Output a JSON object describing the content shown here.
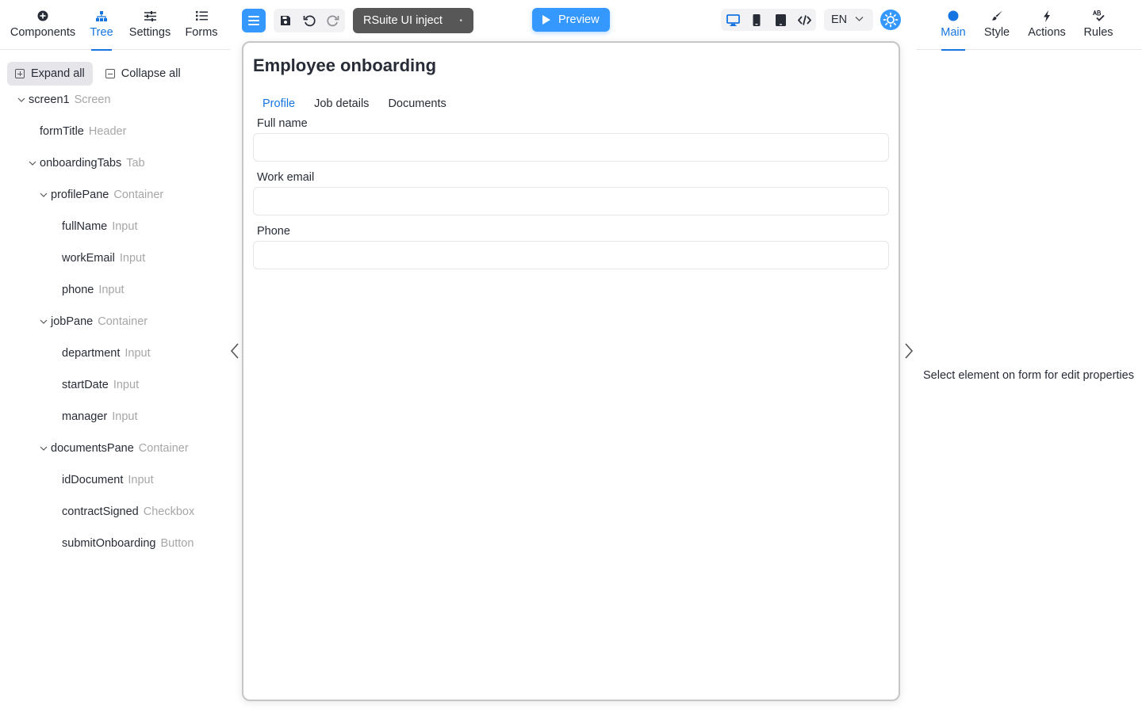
{
  "left_tabs": [
    {
      "label": "Components",
      "icon": "plus-circle-icon",
      "active": false
    },
    {
      "label": "Tree",
      "icon": "sitemap-icon",
      "active": true
    },
    {
      "label": "Settings",
      "icon": "sliders-icon",
      "active": false
    },
    {
      "label": "Forms",
      "icon": "list-icon",
      "active": false
    }
  ],
  "tree_toolbar": {
    "expand_all": "Expand all",
    "collapse_all": "Collapse all"
  },
  "tree": [
    {
      "name": "screen1",
      "type": "Screen",
      "depth": 0,
      "expandable": true
    },
    {
      "name": "formTitle",
      "type": "Header",
      "depth": 1,
      "expandable": false
    },
    {
      "name": "onboardingTabs",
      "type": "Tab",
      "depth": 1,
      "expandable": true
    },
    {
      "name": "profilePane",
      "type": "Container",
      "depth": 2,
      "expandable": true
    },
    {
      "name": "fullName",
      "type": "Input",
      "depth": 3,
      "expandable": false
    },
    {
      "name": "workEmail",
      "type": "Input",
      "depth": 3,
      "expandable": false
    },
    {
      "name": "phone",
      "type": "Input",
      "depth": 3,
      "expandable": false
    },
    {
      "name": "jobPane",
      "type": "Container",
      "depth": 2,
      "expandable": true
    },
    {
      "name": "department",
      "type": "Input",
      "depth": 3,
      "expandable": false
    },
    {
      "name": "startDate",
      "type": "Input",
      "depth": 3,
      "expandable": false
    },
    {
      "name": "manager",
      "type": "Input",
      "depth": 3,
      "expandable": false
    },
    {
      "name": "documentsPane",
      "type": "Container",
      "depth": 2,
      "expandable": true
    },
    {
      "name": "idDocument",
      "type": "Input",
      "depth": 3,
      "expandable": false
    },
    {
      "name": "contractSigned",
      "type": "Checkbox",
      "depth": 3,
      "expandable": false
    },
    {
      "name": "submitOnboarding",
      "type": "Button",
      "depth": 3,
      "expandable": false
    }
  ],
  "toolbar": {
    "library": "RSuite UI inject",
    "preview": "Preview",
    "language": "EN"
  },
  "form": {
    "title": "Employee onboarding",
    "tabs": [
      "Profile",
      "Job details",
      "Documents"
    ],
    "active_tab": "Profile",
    "fields": [
      {
        "label": "Full name",
        "value": ""
      },
      {
        "label": "Work email",
        "value": ""
      },
      {
        "label": "Phone",
        "value": ""
      }
    ]
  },
  "right_tabs": [
    {
      "label": "Main",
      "icon": "circle-icon",
      "active": true
    },
    {
      "label": "Style",
      "icon": "brush-icon",
      "active": false
    },
    {
      "label": "Actions",
      "icon": "lightning-icon",
      "active": false
    },
    {
      "label": "Rules",
      "icon": "spellcheck-icon",
      "active": false
    }
  ],
  "properties_placeholder": "Select element on form for edit properties",
  "colors": {
    "accent": "#3498ff",
    "active_text": "#1675e0",
    "muted_text": "#a6a6a6",
    "dark_select": "#575757"
  }
}
